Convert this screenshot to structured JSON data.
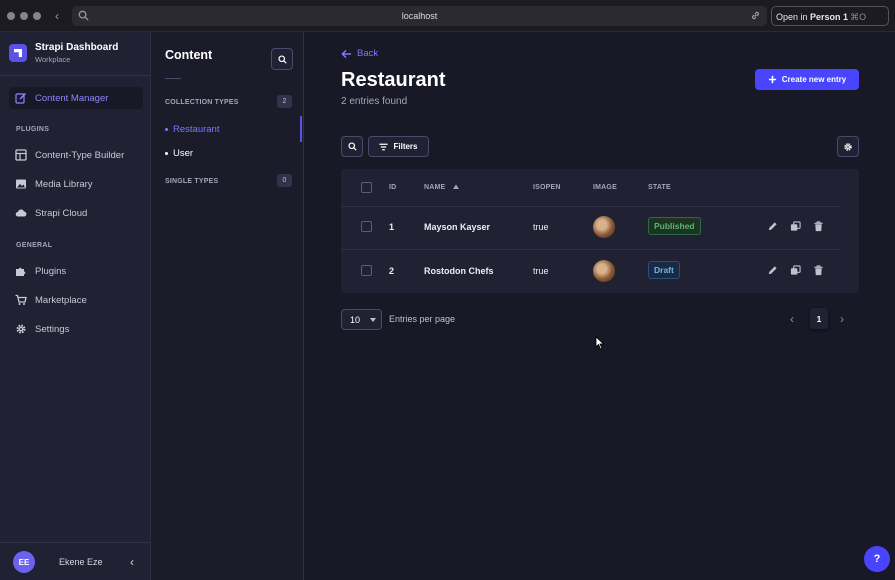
{
  "browser": {
    "url": "localhost",
    "open_in_prefix": "Open in ",
    "open_in_profile": "Person 1",
    "open_in_shortcut": "⌘O"
  },
  "sidebar": {
    "app_title": "Strapi Dashboard",
    "app_subtitle": "Workplace",
    "content_manager": "Content Manager",
    "plugins_heading": "PLUGINS",
    "plugins": [
      "Content-Type Builder",
      "Media Library",
      "Strapi Cloud"
    ],
    "general_heading": "GENERAL",
    "general": [
      "Plugins",
      "Marketplace",
      "Settings"
    ],
    "user_initials": "EE",
    "user_name": "Ekene Eze",
    "collapse_glyph": "‹"
  },
  "subnav": {
    "title": "Content",
    "collection_types_heading": "COLLECTION TYPES",
    "collection_types_count": "2",
    "collection_types": [
      "Restaurant",
      "User"
    ],
    "single_types_heading": "SINGLE TYPES",
    "single_types_count": "0"
  },
  "main": {
    "back_label": "Back",
    "title": "Restaurant",
    "subtitle": "2 entries found",
    "create_button": "Create new entry",
    "filters_button": "Filters",
    "columns": [
      "ID",
      "NAME",
      "ISOPEN",
      "IMAGE",
      "STATE"
    ],
    "rows": [
      {
        "id": "1",
        "name": "Mayson Kayser",
        "isopen": "true",
        "state": "Published"
      },
      {
        "id": "2",
        "name": "Rostodon Chefs",
        "isopen": "true",
        "state": "Draft"
      }
    ],
    "per_page_value": "10",
    "per_page_label": "Entries per page",
    "current_page": "1"
  },
  "help_label": "?",
  "colors": {
    "accent": "#4945ff",
    "published": "#5cb176",
    "draft": "#66b7f1",
    "link": "#7b79ff"
  }
}
